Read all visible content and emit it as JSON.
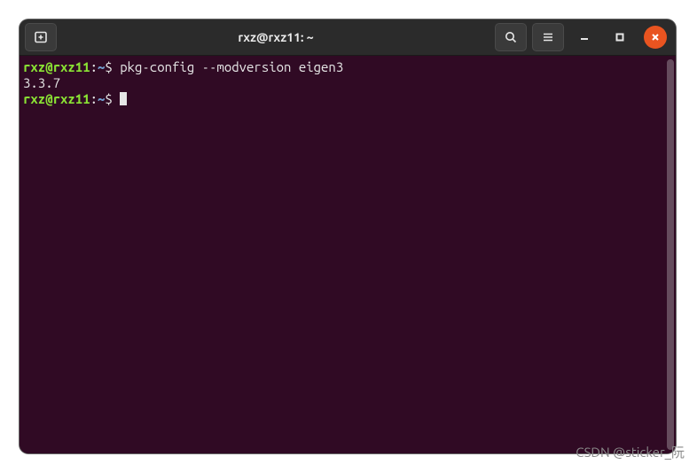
{
  "window": {
    "title": "rxz@rxz11: ~"
  },
  "prompt": {
    "user_host": "rxz@rxz11",
    "colon": ":",
    "path": "~",
    "symbol": "$"
  },
  "lines": {
    "cmd1": "pkg-config --modversion eigen3",
    "out1": "3.3.7"
  },
  "watermark": "CSDN @sticker_阮"
}
